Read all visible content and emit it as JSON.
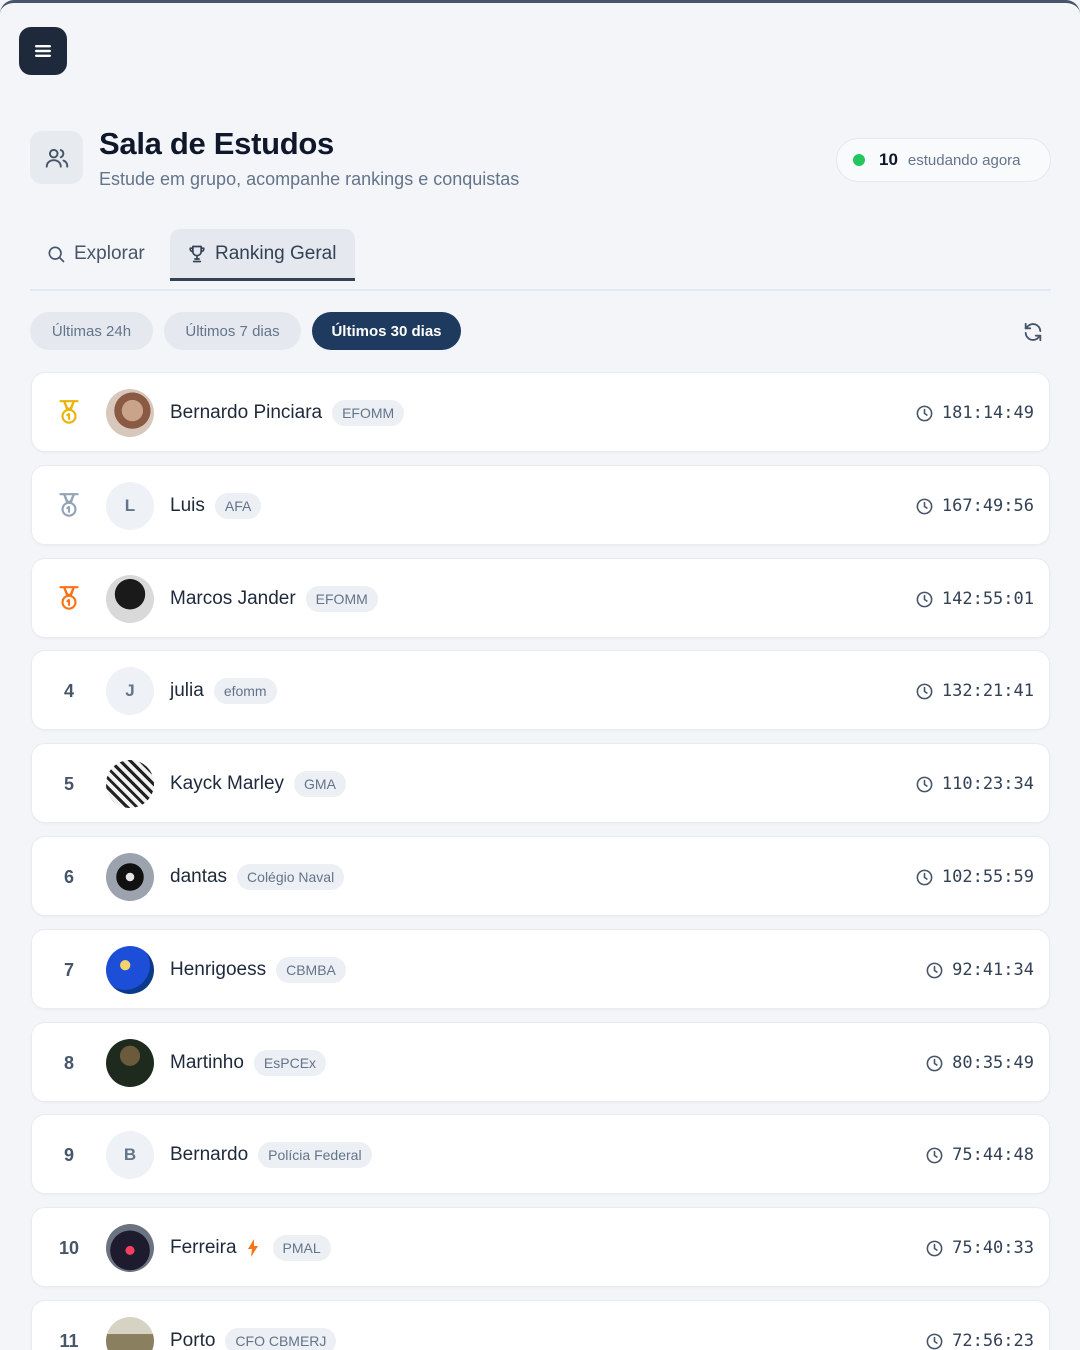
{
  "header": {
    "title": "Sala de Estudos",
    "subtitle": "Estude em grupo, acompanhe rankings e conquistas",
    "online_count": "10",
    "online_label": "estudando agora"
  },
  "tabs": [
    {
      "label": "Explorar",
      "icon": "search-icon",
      "active": false
    },
    {
      "label": "Ranking Geral",
      "icon": "trophy-icon",
      "active": true
    }
  ],
  "period_filters": [
    {
      "label": "Últimas 24h",
      "active": false
    },
    {
      "label": "Últimos 7 dias",
      "active": false
    },
    {
      "label": "Últimos 30 dias",
      "active": true
    }
  ],
  "colors": {
    "accent": "#1e3a5f",
    "online": "#22c55e",
    "gold": "#eab308",
    "silver": "#94a3b8",
    "bronze": "#f97316"
  },
  "ranking": [
    {
      "rank": "1",
      "medal": "gold",
      "name": "Bernardo Pinciara",
      "tag": "EFOMM",
      "time": "181:14:49",
      "avatar": "photo"
    },
    {
      "rank": "2",
      "medal": "silver",
      "name": "Luis",
      "tag": "AFA",
      "time": "167:49:56",
      "avatar": "L"
    },
    {
      "rank": "3",
      "medal": "bronze",
      "name": "Marcos Jander",
      "tag": "EFOMM",
      "time": "142:55:01",
      "avatar": "photo"
    },
    {
      "rank": "4",
      "name": "julia",
      "tag": "efomm",
      "time": "132:21:41",
      "avatar": "J"
    },
    {
      "rank": "5",
      "name": "Kayck Marley",
      "tag": "GMA",
      "time": "110:23:34",
      "avatar": "photo"
    },
    {
      "rank": "6",
      "name": "dantas",
      "tag": "Colégio Naval",
      "time": "102:55:59",
      "avatar": "photo"
    },
    {
      "rank": "7",
      "name": "Henrigoess",
      "tag": "CBMBA",
      "time": "92:41:34",
      "avatar": "photo"
    },
    {
      "rank": "8",
      "name": "Martinho",
      "tag": "EsPCEx",
      "time": "80:35:49",
      "avatar": "photo"
    },
    {
      "rank": "9",
      "name": "Bernardo",
      "tag": "Polícia Federal",
      "time": "75:44:48",
      "avatar": "B"
    },
    {
      "rank": "10",
      "name": "Ferreira",
      "tag": "PMAL",
      "time": "75:40:33",
      "avatar": "photo",
      "streak_icon": "bolt-icon"
    },
    {
      "rank": "11",
      "name": "Porto",
      "tag": "CFO CBMERJ",
      "time": "72:56:23",
      "avatar": "photo"
    }
  ]
}
